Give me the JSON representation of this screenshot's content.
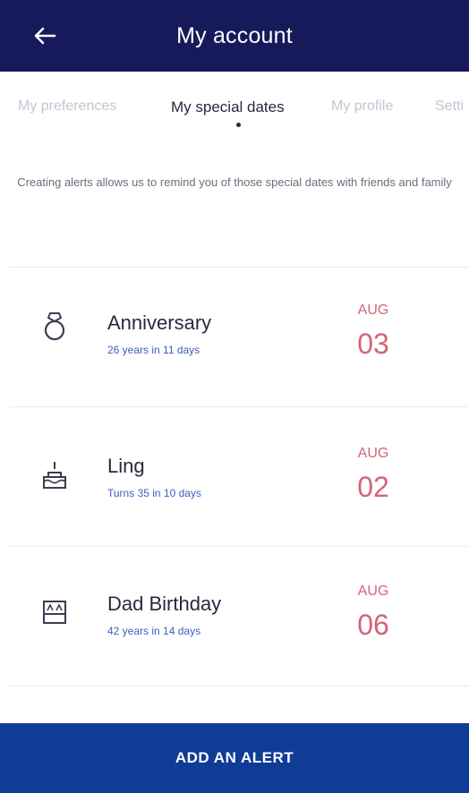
{
  "header": {
    "title": "My account"
  },
  "tabs": [
    {
      "label": "My preferences"
    },
    {
      "label": "My special dates"
    },
    {
      "label": "My profile"
    },
    {
      "label": "Setti"
    }
  ],
  "intro": "Creating alerts allows us to remind you of those special dates with friends and family",
  "alerts": [
    {
      "name": "Anniversary",
      "detail": "26 years in 11 days",
      "month": "AUG",
      "day": "03",
      "icon": "ring-icon"
    },
    {
      "name": "Ling",
      "detail": "Turns 35 in 10 days",
      "month": "AUG",
      "day": "02",
      "icon": "cake-icon"
    },
    {
      "name": "Dad Birthday",
      "detail": "42 years in 14 days",
      "month": "AUG",
      "day": "06",
      "icon": "calendar-icon"
    }
  ],
  "footer": {
    "button_label": "ADD AN ALERT"
  },
  "colors": {
    "header": "#16195a",
    "accent_date": "#d46478",
    "link_blue": "#3d5ec1",
    "button": "#0f3c96"
  }
}
